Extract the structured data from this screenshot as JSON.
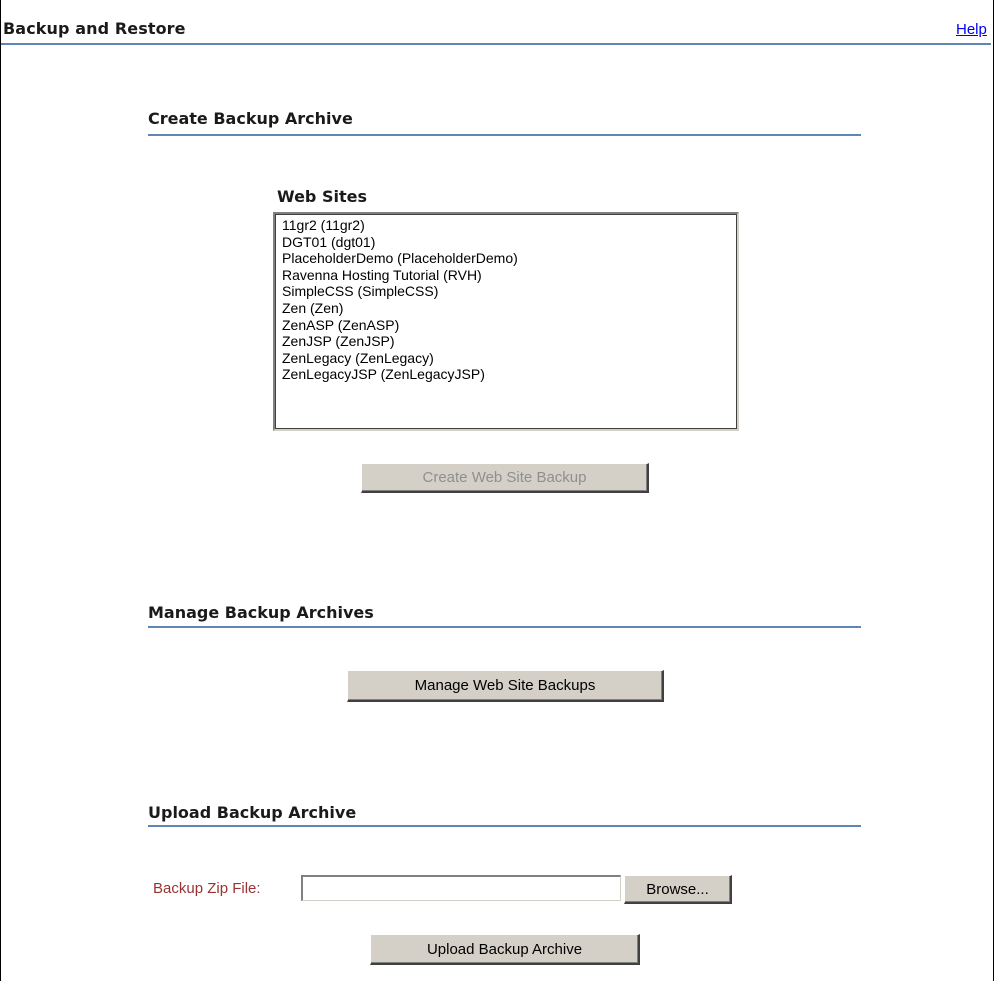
{
  "header": {
    "title": "Backup and Restore",
    "help_label": "Help"
  },
  "create_section": {
    "title": "Create Backup Archive",
    "list_title": "Web Sites",
    "sites": [
      "11gr2 (11gr2)",
      "DGT01 (dgt01)",
      "PlaceholderDemo (PlaceholderDemo)",
      "Ravenna Hosting Tutorial (RVH)",
      "SimpleCSS (SimpleCSS)",
      "Zen (Zen)",
      "ZenASP (ZenASP)",
      "ZenJSP (ZenJSP)",
      "ZenLegacy (ZenLegacy)",
      "ZenLegacyJSP (ZenLegacyJSP)"
    ],
    "create_button_label": "Create Web Site Backup"
  },
  "manage_section": {
    "title": "Manage Backup Archives",
    "manage_button_label": "Manage Web Site Backups"
  },
  "upload_section": {
    "title": "Upload Backup Archive",
    "file_label": "Backup Zip File:",
    "file_value": "",
    "browse_label": "Browse...",
    "upload_button_label": "Upload Backup Archive"
  },
  "colors": {
    "rule": "#5f86b4",
    "label_red": "#993333",
    "button_face": "#d4d0c8",
    "link": "#0000ee"
  }
}
